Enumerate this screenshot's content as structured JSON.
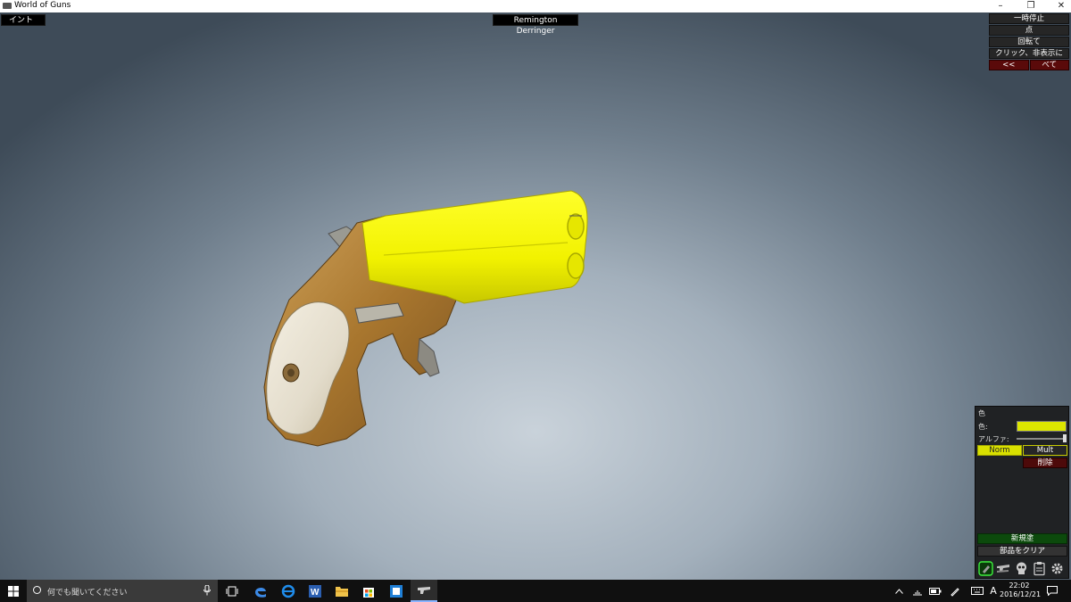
{
  "window": {
    "title": "World of Guns"
  },
  "hud": {
    "intro_label": "イント",
    "model_name": "Remington Derringer"
  },
  "right_menu": {
    "pause": "一時停止",
    "point": "点",
    "rotate": "回転て",
    "click_hide": "クリック、非表示に",
    "back": "<<",
    "all": "べて"
  },
  "color_panel": {
    "header": "色",
    "color_label": "色:",
    "alpha_label": "アルファ:",
    "mode_norm": "Norm",
    "mode_mult": "Mult",
    "delete": "削除",
    "new_paint": "新規塗",
    "clear_parts": "部品をクリア",
    "selected_color": "#dce600",
    "alpha_value": 1.0,
    "tool_icons": [
      "paint-bucket-icon",
      "guns-icon",
      "skull-icon",
      "clipboard-icon",
      "settings-gear-icon"
    ]
  },
  "taskbar": {
    "search_placeholder": "何でも聞いてください",
    "time": "22:02",
    "date": "2016/12/21",
    "ime": "A",
    "apps": [
      "task-view-icon",
      "edge-icon",
      "ie-icon",
      "word-icon",
      "file-explorer-icon",
      "store-icon",
      "photos-app-icon",
      "world-of-guns-icon"
    ]
  },
  "colors": {
    "barrel_yellow": "#f2f200",
    "ivory_grip": "#e8e2d2",
    "brass_frame": "#b8863a",
    "panel_green": "#0c4a0c",
    "panel_red": "#5a0a0a"
  }
}
